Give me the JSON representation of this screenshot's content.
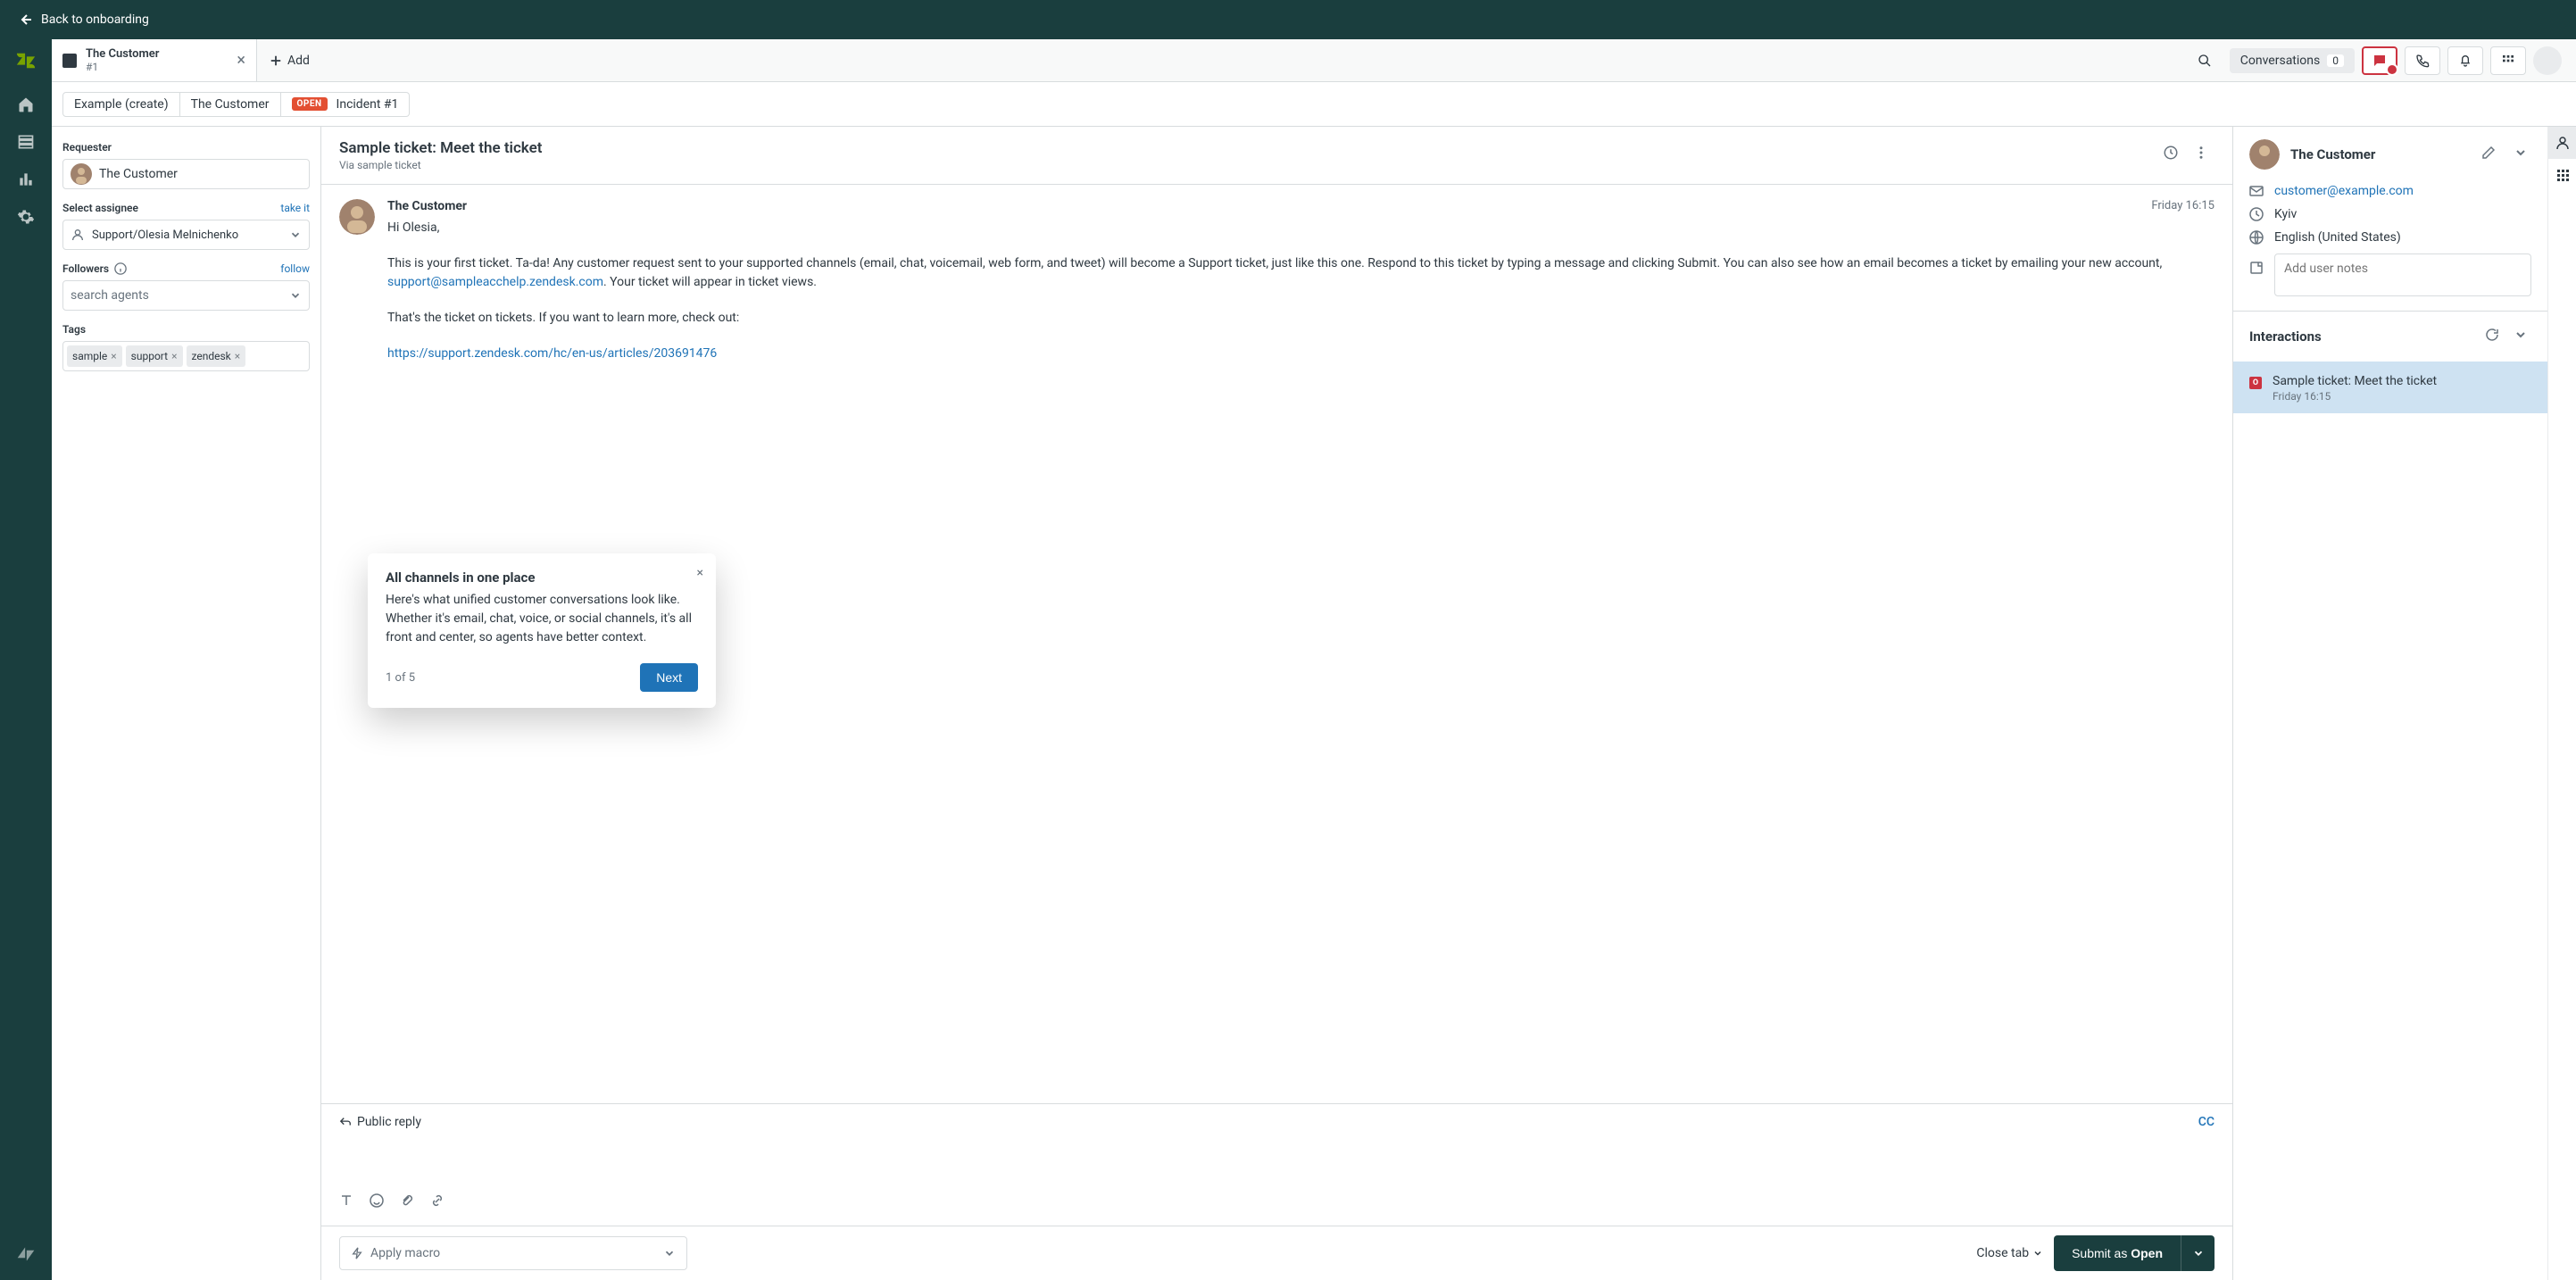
{
  "banner": {
    "back": "Back to onboarding"
  },
  "tab": {
    "title": "The Customer",
    "sub": "#1",
    "add": "Add"
  },
  "topright": {
    "conversations": "Conversations",
    "conv_count": "0"
  },
  "crumbs": {
    "seg1": "Example (create)",
    "seg2": "The Customer",
    "status": "OPEN",
    "seg3": "Incident #1"
  },
  "left": {
    "requester_lbl": "Requester",
    "requester_val": "The Customer",
    "assignee_lbl": "Select assignee",
    "takeit": "take it",
    "assignee_val": "Support/Olesia Melnichenko",
    "followers_lbl": "Followers",
    "follow": "follow",
    "search_ph": "search agents",
    "tags_lbl": "Tags",
    "tags": [
      "sample",
      "support",
      "zendesk"
    ]
  },
  "ticket": {
    "title": "Sample ticket: Meet the ticket",
    "via": "Via sample ticket",
    "author": "The Customer",
    "time": "Friday 16:15",
    "greeting": "Hi Olesia,",
    "body1a": "This is your first ticket. Ta-da! Any customer request sent to your supported channels (email, chat, voicemail, web form, and tweet) will become a Support ticket, just like this one. Respond to this ticket by typing a message and clicking Submit. You can also see how an email becomes a ticket by emailing your new account, ",
    "email_link": "support@sampleacchelp.zendesk.com",
    "body1b": ". Your ticket will appear in ticket views.",
    "body2": "That's the ticket on tickets. If you want to learn more, check out:",
    "link2": "https://support.zendesk.com/hc/en-us/articles/203691476"
  },
  "popover": {
    "title": "All channels in one place",
    "body": "Here's what unified customer conversations look like. Whether it's email, chat, voice, or social channels, it's all front and center, so agents have better context.",
    "count": "1 of 5",
    "next": "Next"
  },
  "reply": {
    "public": "Public reply",
    "cc": "CC"
  },
  "bottom": {
    "macro": "Apply macro",
    "closetab": "Close tab",
    "submit_prefix": "Submit as ",
    "submit_status": "Open"
  },
  "rpanel": {
    "name": "The Customer",
    "email": "customer@example.com",
    "location": "Kyiv",
    "language": "English (United States)",
    "notes_ph": "Add user notes",
    "interactions": "Interactions",
    "int_title": "Sample ticket: Meet the ticket",
    "int_date": "Friday 16:15"
  }
}
